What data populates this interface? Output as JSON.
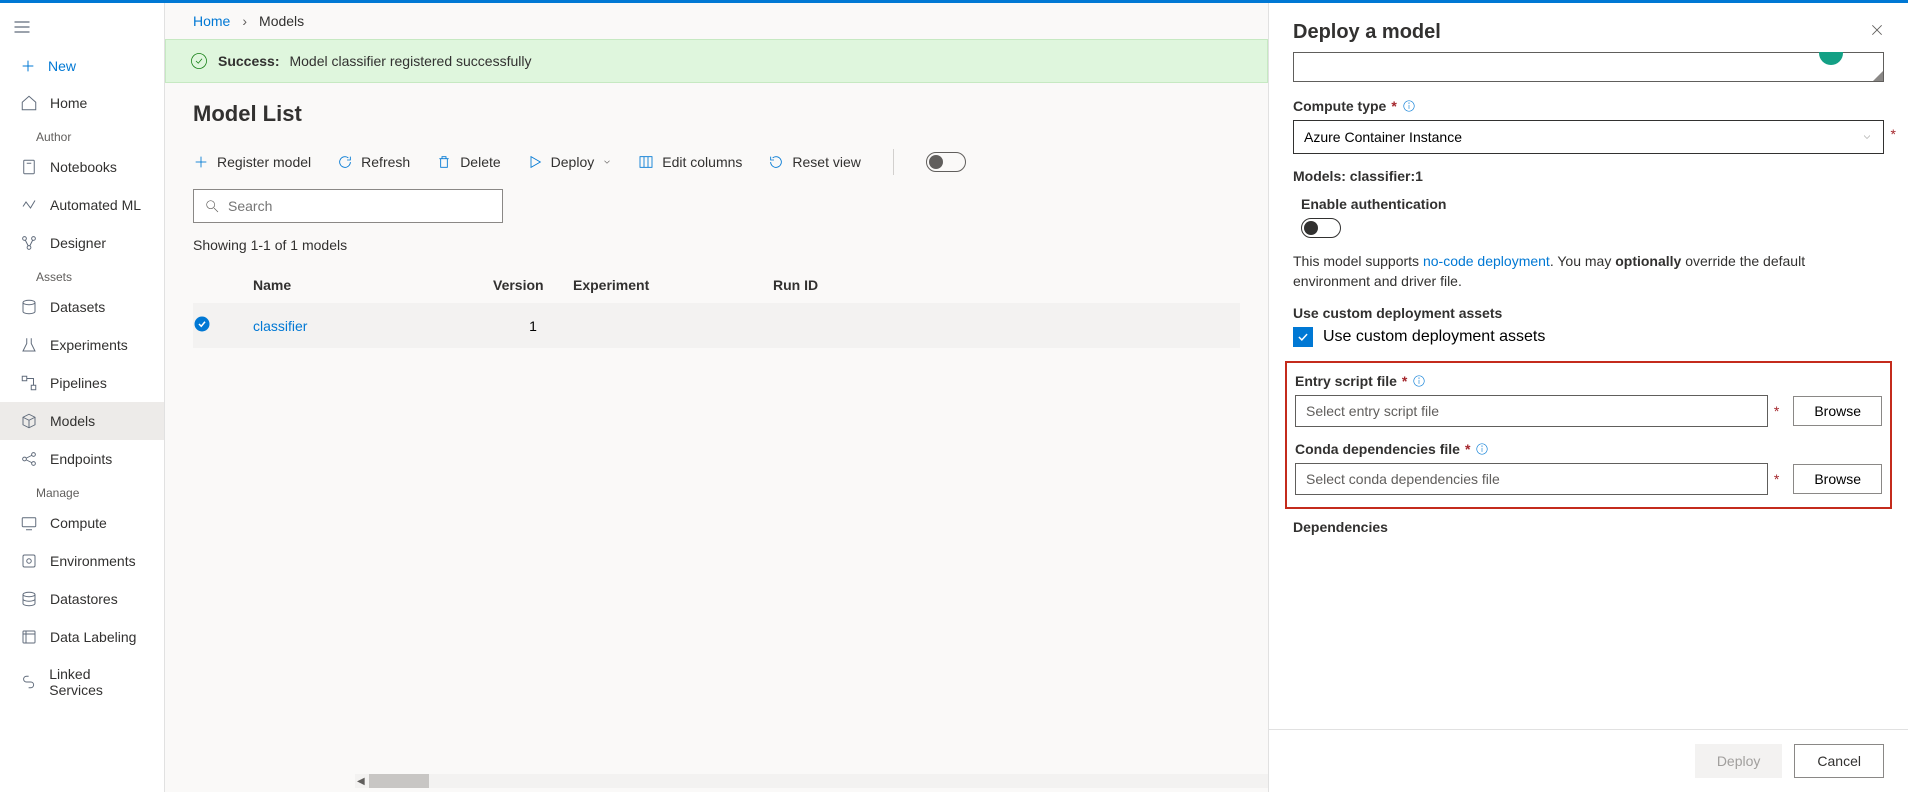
{
  "sidebar": {
    "new_label": "New",
    "home": "Home",
    "sections": {
      "author": "Author",
      "assets": "Assets",
      "manage": "Manage"
    },
    "items": {
      "notebooks": "Notebooks",
      "automated_ml": "Automated ML",
      "designer": "Designer",
      "datasets": "Datasets",
      "experiments": "Experiments",
      "pipelines": "Pipelines",
      "models": "Models",
      "endpoints": "Endpoints",
      "compute": "Compute",
      "environments": "Environments",
      "datastores": "Datastores",
      "data_labeling": "Data Labeling",
      "linked_services": "Linked Services"
    }
  },
  "breadcrumb": {
    "home": "Home",
    "current": "Models"
  },
  "banner": {
    "label": "Success:",
    "message": "Model classifier registered successfully"
  },
  "page_title": "Model List",
  "toolbar": {
    "register": "Register model",
    "refresh": "Refresh",
    "delete": "Delete",
    "deploy": "Deploy",
    "edit_columns": "Edit columns",
    "reset_view": "Reset view"
  },
  "search_placeholder": "Search",
  "result_text": "Showing 1-1 of 1 models",
  "table": {
    "headers": {
      "name": "Name",
      "version": "Version",
      "experiment": "Experiment",
      "run_id": "Run ID"
    },
    "rows": [
      {
        "name": "classifier",
        "version": "1",
        "experiment": "",
        "run_id": ""
      }
    ]
  },
  "panel": {
    "title": "Deploy a model",
    "compute_type_label": "Compute type",
    "compute_type_value": "Azure Container Instance",
    "models_label": "Models: classifier:1",
    "enable_auth": "Enable authentication",
    "desc_prefix": "This model supports ",
    "desc_link": "no-code deployment",
    "desc_mid": ". You may ",
    "desc_bold": "optionally",
    "desc_suffix": " override the default environment and driver file.",
    "custom_assets_label": "Use custom deployment assets",
    "custom_assets_check": "Use custom deployment assets",
    "entry_script_label": "Entry script file",
    "entry_script_placeholder": "Select entry script file",
    "conda_label": "Conda dependencies file",
    "conda_placeholder": "Select conda dependencies file",
    "browse": "Browse",
    "dependencies_label": "Dependencies",
    "deploy_btn": "Deploy",
    "cancel_btn": "Cancel"
  }
}
